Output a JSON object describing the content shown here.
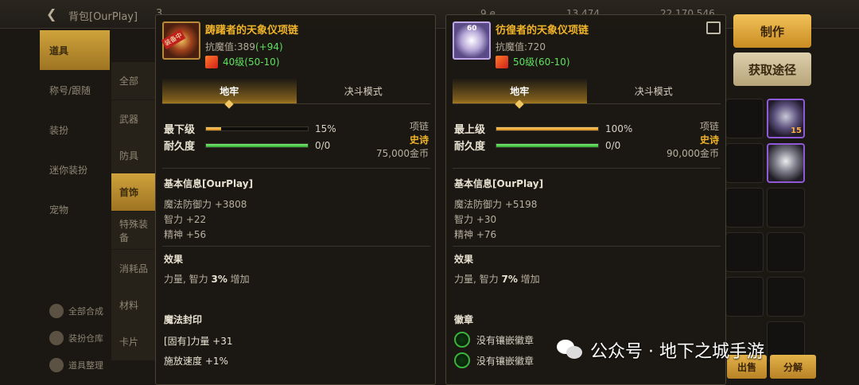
{
  "background": {
    "window_title": "背包[OurPlay]",
    "title_tail": "3",
    "resources": [
      "9 e",
      "13,474",
      "22,170,546"
    ],
    "categories": [
      "道具",
      "称号/跟随",
      "装扮",
      "迷你装扮",
      "宠物"
    ],
    "sub_categories": [
      "全部",
      "武器",
      "防具",
      "首饰",
      "特殊装备",
      "消耗品",
      "材料",
      "卡片"
    ],
    "side_buttons": [
      "全部合成",
      "装扮仓库",
      "道具整理"
    ],
    "slot_badge": "15",
    "make_button": "制作",
    "source_button": "获取途径",
    "bottom_buttons": [
      "出售",
      "分解"
    ]
  },
  "left_item": {
    "name": "踌躇者的天象仪项链",
    "icon_tag": "装备中",
    "resist_label": "抗魔值:389",
    "resist_bonus": "(+94)",
    "level_text": "40级(50-10)",
    "tabs": [
      "地牢",
      "决斗模式"
    ],
    "grade_label": "最下级",
    "grade_value": "15%",
    "grade_fraction": 0.15,
    "durability_label": "耐久度",
    "durability_value": "0/0",
    "durability_fraction": 1.0,
    "slot_type": "项链",
    "rarity": "史诗",
    "price": "75,000金币",
    "basic_title": "基本信息[OurPlay]",
    "stats": [
      "魔法防御力 +3808",
      "智力 +22",
      "精神 +56"
    ],
    "effect_title": "效果",
    "effect_prefix": "力量, 智力",
    "effect_num": "3%",
    "effect_suffix": "增加",
    "seal_title": "魔法封印",
    "seal_lines": [
      "[固有]力量 +31",
      "施放速度 +1%"
    ]
  },
  "right_item": {
    "name": "彷徨者的天象仪项链",
    "icon_tag": "60",
    "resist_label": "抗魔值:720",
    "level_text": "50级(60-10)",
    "tabs": [
      "地牢",
      "决斗模式"
    ],
    "grade_label": "最上级",
    "grade_value": "100%",
    "grade_fraction": 1.0,
    "durability_label": "耐久度",
    "durability_value": "0/0",
    "durability_fraction": 1.0,
    "slot_type": "项链",
    "rarity": "史诗",
    "price": "90,000金币",
    "basic_title": "基本信息[OurPlay]",
    "stats": [
      "魔法防御力 +5198",
      "智力 +30",
      "精神 +76"
    ],
    "effect_title": "效果",
    "effect_prefix": "力量, 智力",
    "effect_num": "7%",
    "effect_suffix": "增加",
    "emblem_title": "徽章",
    "emblems": [
      "没有镶嵌徽章",
      "没有镶嵌徽章"
    ]
  },
  "watermark": "公众号 · 地下之城手游",
  "colors": {
    "accent_gold": "#f1b429",
    "green": "#5ee05e",
    "panel_bg": "#1c1914"
  }
}
